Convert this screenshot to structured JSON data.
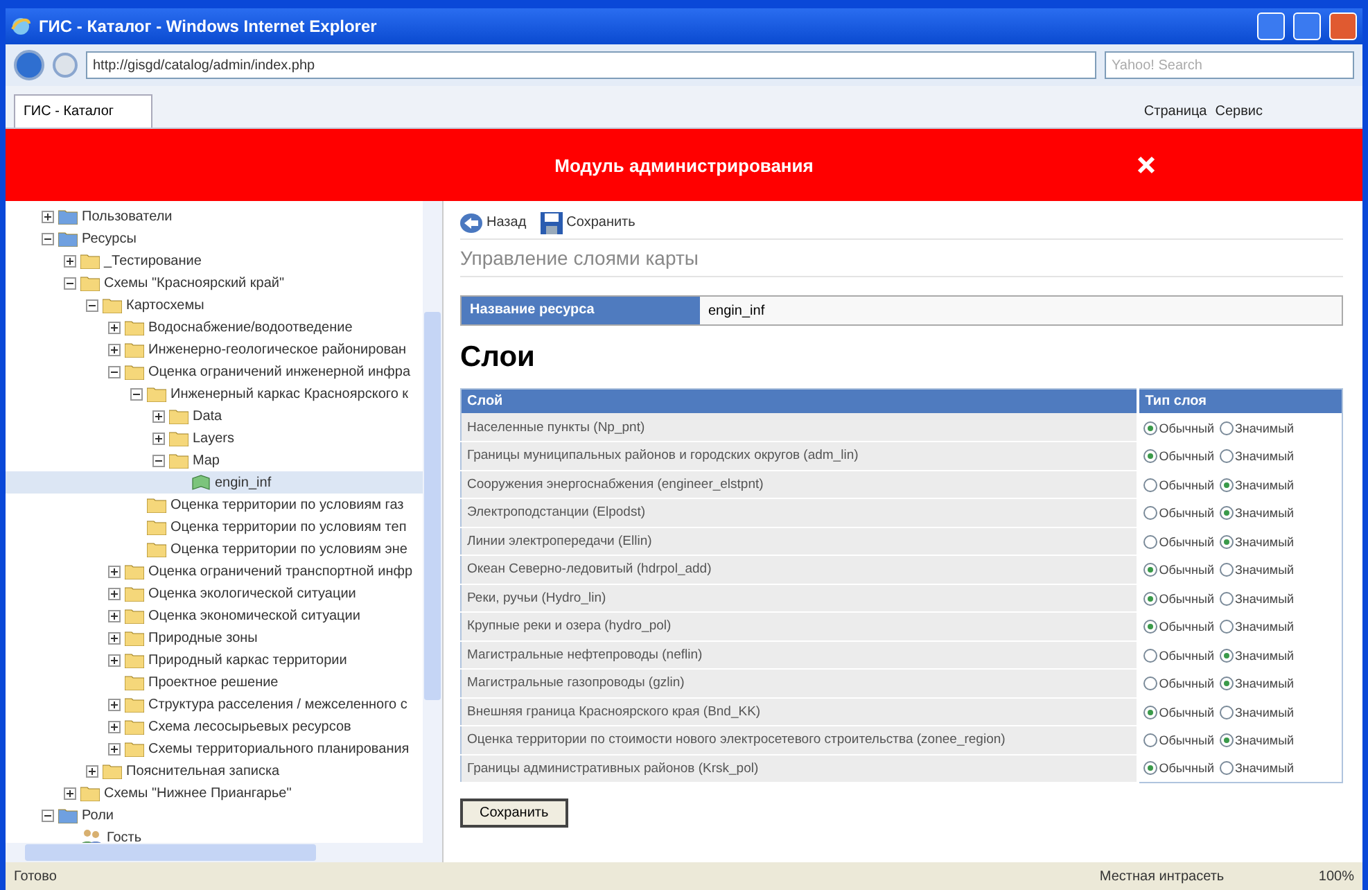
{
  "window": {
    "title": "ГИС - Каталог - Windows Internet Explorer"
  },
  "address_bar": {
    "url": "http://gisgd/catalog/admin/index.php"
  },
  "search": {
    "placeholder": "Yahoo! Search"
  },
  "tabs": [
    {
      "label": "ГИС - Каталог",
      "selected": true
    }
  ],
  "command_bar": [
    {
      "label": "Страница"
    },
    {
      "label": "Сервис"
    }
  ],
  "header": {
    "title": "Модуль администрирования"
  },
  "tree": [
    {
      "label": "Пользователи",
      "kind": "root",
      "expanded": false,
      "selected": false
    },
    {
      "label": "Ресурсы",
      "kind": "root",
      "expanded": true,
      "selected": false,
      "children": [
        {
          "label": "_Тестирование",
          "kind": "folder",
          "expanded": false,
          "selected": false
        },
        {
          "label": "Схемы \"Красноярский край\"",
          "kind": "folder",
          "expanded": true,
          "selected": false,
          "children": [
            {
              "label": "Картосхемы",
              "kind": "folder",
              "expanded": true,
              "selected": false,
              "children": [
                {
                  "label": "Водоснабжение/водоотведение",
                  "kind": "folder",
                  "expanded": false,
                  "selected": false
                },
                {
                  "label": "Инженерно-геологическое районирован",
                  "kind": "folder",
                  "expanded": false,
                  "selected": false
                },
                {
                  "label": "Оценка ограничений инженерной инфра",
                  "kind": "folder",
                  "expanded": true,
                  "selected": false,
                  "children": [
                    {
                      "label": "Инженерный каркас Красноярского к",
                      "kind": "folder",
                      "expanded": true,
                      "selected": false,
                      "children": [
                        {
                          "label": "Data",
                          "kind": "folder",
                          "expanded": false,
                          "selected": false
                        },
                        {
                          "label": "Layers",
                          "kind": "folder",
                          "expanded": false,
                          "selected": false
                        },
                        {
                          "label": "Map",
                          "kind": "folder",
                          "expanded": true,
                          "selected": false,
                          "children": [
                            {
                              "label": "engin_inf",
                              "kind": "layer",
                              "selected": true
                            }
                          ]
                        }
                      ]
                    },
                    {
                      "label": "Оценка территории по условиям газ",
                      "kind": "folder",
                      "selected": false
                    },
                    {
                      "label": "Оценка территории по условиям теп",
                      "kind": "folder",
                      "selected": false
                    },
                    {
                      "label": "Оценка территории по условиям эне",
                      "kind": "folder",
                      "selected": false
                    }
                  ]
                },
                {
                  "label": "Оценка ограничений транспортной инфр",
                  "kind": "folder",
                  "expanded": false,
                  "selected": false
                },
                {
                  "label": "Оценка экологической ситуации",
                  "kind": "folder",
                  "expanded": false,
                  "selected": false
                },
                {
                  "label": "Оценка экономической ситуации",
                  "kind": "folder",
                  "expanded": false,
                  "selected": false
                },
                {
                  "label": "Природные зоны",
                  "kind": "folder",
                  "expanded": false,
                  "selected": false
                },
                {
                  "label": "Природный каркас территории",
                  "kind": "folder",
                  "expanded": false,
                  "selected": false
                },
                {
                  "label": "Проектное решение",
                  "kind": "folder",
                  "selected": false
                },
                {
                  "label": "Структура расселения / межселенного с",
                  "kind": "folder",
                  "expanded": false,
                  "selected": false
                },
                {
                  "label": "Схема лесосырьевых ресурсов",
                  "kind": "folder",
                  "expanded": false,
                  "selected": false
                },
                {
                  "label": "Схемы территориального планирования",
                  "kind": "folder",
                  "expanded": false,
                  "selected": false
                }
              ]
            },
            {
              "label": "Пояснительная записка",
              "kind": "folder",
              "expanded": false,
              "selected": false
            }
          ]
        },
        {
          "label": "Схемы \"Нижнее Приангарье\"",
          "kind": "folder",
          "expanded": false,
          "selected": false
        }
      ]
    },
    {
      "label": "Роли",
      "kind": "root",
      "expanded": true,
      "selected": false,
      "children": [
        {
          "label": "Гость",
          "kind": "user",
          "selected": false
        }
      ]
    }
  ],
  "toolbar": [
    {
      "label": "Назад",
      "kind": "back"
    },
    {
      "label": "Сохранить",
      "kind": "save"
    }
  ],
  "page_title": "Управление слоями карты",
  "resource": {
    "label": "Название ресурса",
    "value": "engin_inf"
  },
  "section_title": "Слои",
  "table": {
    "columns": [
      "Слой",
      "Тип слоя"
    ],
    "rows": [
      {
        "name": "Населенные пункты (Np_pnt)",
        "options": [
          {
            "label": "Обычный",
            "selected": true
          },
          {
            "label": "Значимый",
            "selected": false
          }
        ]
      },
      {
        "name": "Границы муниципальных районов и городских округов (adm_lin)",
        "options": [
          {
            "label": "Обычный",
            "selected": true
          },
          {
            "label": "Значимый",
            "selected": false
          }
        ]
      },
      {
        "name": "Сооружения энергоснабжения (engineer_elstpnt)",
        "options": [
          {
            "label": "Обычный",
            "selected": false
          },
          {
            "label": "Значимый",
            "selected": true
          }
        ]
      },
      {
        "name": "Электроподстанции (Elpodst)",
        "options": [
          {
            "label": "Обычный",
            "selected": false
          },
          {
            "label": "Значимый",
            "selected": true
          }
        ]
      },
      {
        "name": "Линии электропередачи (Ellin)",
        "options": [
          {
            "label": "Обычный",
            "selected": false
          },
          {
            "label": "Значимый",
            "selected": true
          }
        ]
      },
      {
        "name": "Океан Северно-ледовитый (hdrpol_add)",
        "options": [
          {
            "label": "Обычный",
            "selected": true
          },
          {
            "label": "Значимый",
            "selected": false
          }
        ]
      },
      {
        "name": "Реки, ручьи (Hydro_lin)",
        "options": [
          {
            "label": "Обычный",
            "selected": true
          },
          {
            "label": "Значимый",
            "selected": false
          }
        ]
      },
      {
        "name": "Крупные реки и озера (hydro_pol)",
        "options": [
          {
            "label": "Обычный",
            "selected": true
          },
          {
            "label": "Значимый",
            "selected": false
          }
        ]
      },
      {
        "name": "Магистральные нефтепроводы (neflin)",
        "options": [
          {
            "label": "Обычный",
            "selected": false
          },
          {
            "label": "Значимый",
            "selected": true
          }
        ]
      },
      {
        "name": "Магистральные газопроводы (gzlin)",
        "options": [
          {
            "label": "Обычный",
            "selected": false
          },
          {
            "label": "Значимый",
            "selected": true
          }
        ]
      },
      {
        "name": "Внешняя граница Красноярского края (Bnd_KK)",
        "options": [
          {
            "label": "Обычный",
            "selected": true
          },
          {
            "label": "Значимый",
            "selected": false
          }
        ]
      },
      {
        "name": "Оценка территории по стоимости нового электросетевого строительства (zonee_region)",
        "options": [
          {
            "label": "Обычный",
            "selected": false
          },
          {
            "label": "Значимый",
            "selected": true
          }
        ]
      },
      {
        "name": "Границы административных районов (Krsk_pol)",
        "options": [
          {
            "label": "Обычный",
            "selected": true
          },
          {
            "label": "Значимый",
            "selected": false
          }
        ]
      }
    ]
  },
  "save_button": "Сохранить",
  "status_bar": {
    "text": "Готово",
    "zone": "Местная интрасеть",
    "zoom": "100%"
  }
}
